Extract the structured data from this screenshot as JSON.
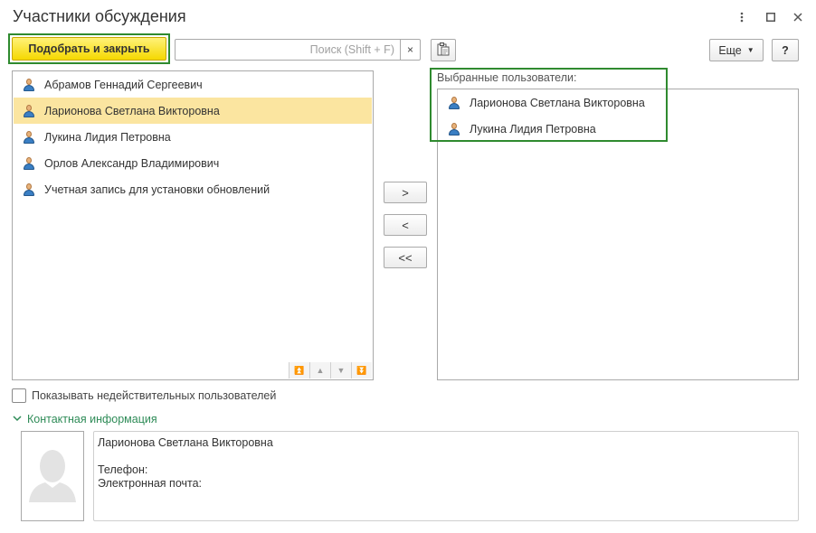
{
  "window": {
    "title": "Участники обсуждения",
    "menu_icon": "more-vertical-icon",
    "maximize_icon": "maximize-icon",
    "close_icon": "close-icon"
  },
  "toolbar": {
    "primary_label": "Подобрать и закрыть",
    "search_placeholder": "Поиск (Shift + F)",
    "search_value": "",
    "clear_glyph": "×",
    "clipboard_icon": "clipboard-icon",
    "more_label": "Еще",
    "help_label": "?"
  },
  "available_users": {
    "items": [
      {
        "label": "Абрамов Геннадий Сергеевич",
        "selected": false
      },
      {
        "label": "Ларионова Светлана Викторовна",
        "selected": true
      },
      {
        "label": "Лукина Лидия Петровна",
        "selected": false
      },
      {
        "label": "Орлов Александр Владимирович",
        "selected": false
      },
      {
        "label": "Учетная запись для установки обновлений",
        "selected": false
      }
    ]
  },
  "move_buttons": {
    "add": ">",
    "remove": "<",
    "remove_all": "<<"
  },
  "selected_users": {
    "label": "Выбранные пользователи:",
    "items": [
      {
        "label": "Ларионова Светлана Викторовна"
      },
      {
        "label": "Лукина Лидия Петровна"
      }
    ]
  },
  "options": {
    "show_invalid_label": "Показывать недействительных пользователей",
    "show_invalid_checked": false
  },
  "contact": {
    "header": "Контактная информация",
    "name": "Ларионова Светлана Викторовна",
    "phone_label": "Телефон:",
    "email_label": "Электронная почта:"
  },
  "colors": {
    "accent_green": "#2f8a2f",
    "primary_yellow": "#f5d800",
    "selection": "#fbe5a0"
  }
}
